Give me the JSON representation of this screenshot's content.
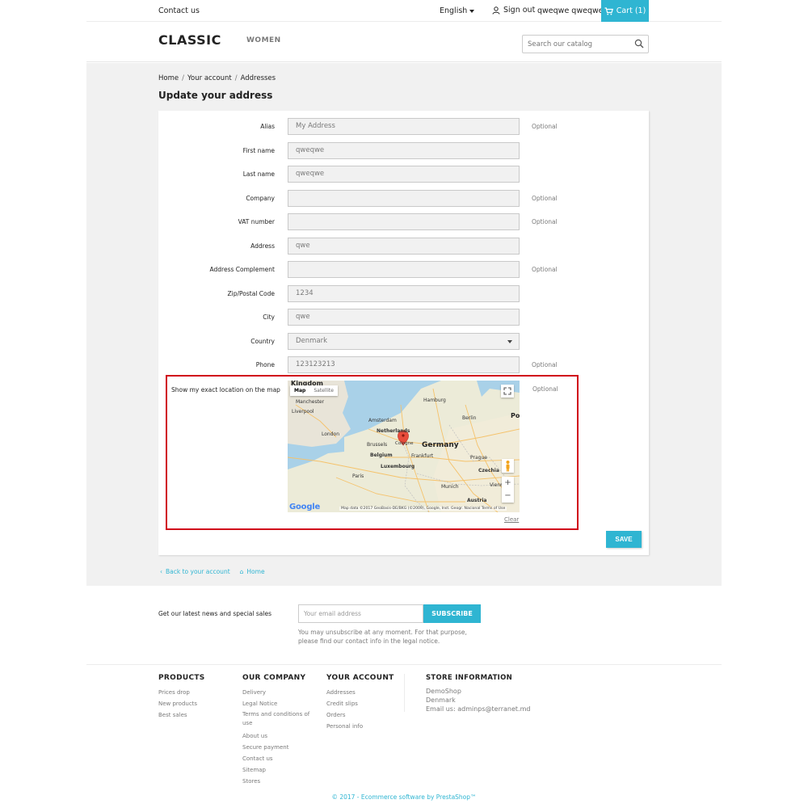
{
  "topnav": {
    "contact": "Contact us",
    "language": "English",
    "signout": "Sign out",
    "username": "qweqwe qweqwe",
    "cart": "Cart (1)"
  },
  "header": {
    "logo": "CLASSIC",
    "menu_women": "WOMEN",
    "search_placeholder": "Search our catalog"
  },
  "breadcrumb": [
    "Home",
    "Your account",
    "Addresses"
  ],
  "page_title": "Update your address",
  "form": {
    "optional_label": "Optional",
    "fields": [
      {
        "label": "Alias",
        "value": "My Address",
        "optional": true
      },
      {
        "label": "First name",
        "value": "qweqwe",
        "optional": false
      },
      {
        "label": "Last name",
        "value": "qweqwe",
        "optional": false
      },
      {
        "label": "Company",
        "value": "",
        "optional": true
      },
      {
        "label": "VAT number",
        "value": "",
        "optional": true
      },
      {
        "label": "Address",
        "value": "qwe",
        "optional": false
      },
      {
        "label": "Address Complement",
        "value": "",
        "optional": true
      },
      {
        "label": "Zip/Postal Code",
        "value": "1234",
        "optional": false
      },
      {
        "label": "City",
        "value": "qwe",
        "optional": false
      },
      {
        "label": "Country",
        "value": "Denmark",
        "optional": false
      },
      {
        "label": "Phone",
        "value": "123123213",
        "optional": true
      }
    ],
    "map_label": "Show my exact location on the map",
    "map_optional": "Optional",
    "clear": "Clear",
    "save": "SAVE"
  },
  "map": {
    "type_map": "Map",
    "type_satellite": "Satellite",
    "cities": [
      "Kingdom",
      "Manchester",
      "Liverpool",
      "London",
      "Amsterdam",
      "Netherlands",
      "Brussels",
      "Belgium",
      "Cologne",
      "Luxembourg",
      "Paris",
      "Hamburg",
      "Berlin",
      "Germany",
      "Frankfurt",
      "Prague",
      "Czechia",
      "Munich",
      "Vienna",
      "Austria",
      "Po"
    ],
    "google": "Google",
    "attribution": "Map data ©2017 GeoBasis-DE/BKG (©2009), Google, Inst. Geogr. Nacional   Terms of Use",
    "zoom_in": "+",
    "zoom_out": "−"
  },
  "back_links": {
    "back": "Back to your account",
    "home": "Home"
  },
  "newsletter": {
    "label": "Get our latest news and special sales",
    "placeholder": "Your email address",
    "button": "SUBSCRIBE",
    "note": "You may unsubscribe at any moment. For that purpose, please find our contact info in the legal notice."
  },
  "footer": {
    "products": {
      "title": "PRODUCTS",
      "links": [
        "Prices drop",
        "New products",
        "Best sales"
      ]
    },
    "company": {
      "title": "OUR COMPANY",
      "links": [
        "Delivery",
        "Legal Notice",
        "Terms and conditions of use",
        "About us",
        "Secure payment",
        "Contact us",
        "Sitemap",
        "Stores"
      ]
    },
    "account": {
      "title": "YOUR ACCOUNT",
      "links": [
        "Addresses",
        "Credit slips",
        "Orders",
        "Personal info"
      ]
    },
    "store": {
      "title": "STORE INFORMATION",
      "lines": [
        "DemoShop",
        "Denmark",
        "Email us: adminps@terranet.md"
      ]
    }
  },
  "copyright": "© 2017 - Ecommerce software by PrestaShop™",
  "colors": {
    "accent": "#2fb5d2",
    "highlight": "#d0011b"
  }
}
